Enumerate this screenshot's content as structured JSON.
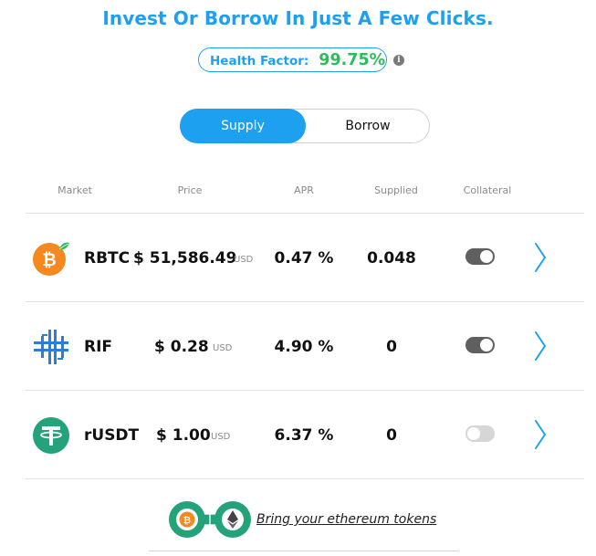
{
  "header": {
    "title": "Invest Or Borrow In Just A Few Clicks."
  },
  "health": {
    "label": "Health Factor:",
    "value": "99.75%",
    "info_icon": "info-icon",
    "info_glyph": "i"
  },
  "tabs": {
    "supply": "Supply",
    "borrow": "Borrow",
    "active": "supply"
  },
  "table": {
    "headers": {
      "market": "Market",
      "price": "Price",
      "apr": "APR",
      "supplied": "Supplied",
      "collateral": "Collateral"
    },
    "rows": [
      {
        "name": "RBTC",
        "price": "$ 51,586.49",
        "currency": "USD",
        "apr": "0.47 %",
        "supplied": "0.048",
        "collateral": true,
        "icon": "rbtc-icon"
      },
      {
        "name": "RIF",
        "price": "$ 0.28",
        "currency": "USD",
        "apr": "4.90 %",
        "supplied": "0",
        "collateral": true,
        "icon": "rif-icon"
      },
      {
        "name": "rUSDT",
        "price": "$ 1.00",
        "currency": "USD",
        "apr": "6.37 %",
        "supplied": "0",
        "collateral": false,
        "icon": "rusdt-icon"
      }
    ]
  },
  "bridge": {
    "link_text": "Bring your ethereum tokens",
    "icon": "bridge-logo-icon"
  },
  "colors": {
    "accent": "#1ea0f0",
    "health_value": "#2bbd5a",
    "rbtc_orange": "#f5891f",
    "rif_blue": "#2a7ed6",
    "tether_green": "#24a27a"
  }
}
